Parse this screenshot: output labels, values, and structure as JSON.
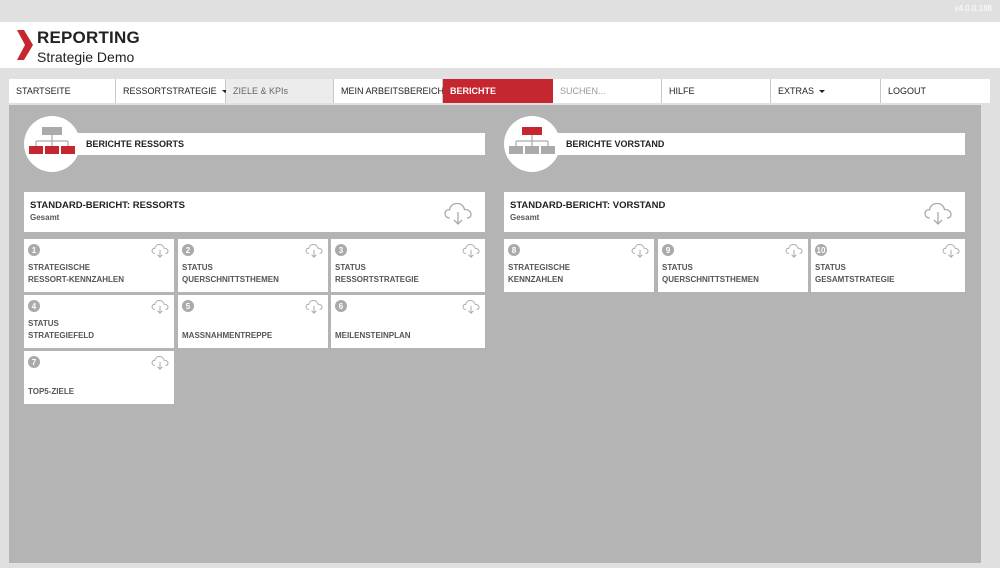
{
  "app": {
    "version": "v4.0.0.188",
    "title": "REPORTING",
    "subtitle": "Strategie Demo"
  },
  "nav": {
    "startseite": "STARTSEITE",
    "ressortstrategie": "RESSORTSTRATEGIE",
    "ziele": "ZIELE & KPIs",
    "arbeitsbereich": "MEIN ARBEITSBEREICH",
    "berichte": "BERICHTE",
    "search_placeholder": "SUCHEN...",
    "hilfe": "HILFE",
    "extras": "EXTRAS",
    "logout": "LOGOUT"
  },
  "left": {
    "section_title": "BERICHTE RESSORTS",
    "standard_title": "STANDARD-BERICHT: RESSORTS",
    "standard_sub": "Gesamt",
    "tiles": [
      {
        "num": "1",
        "label": "STRATEGISCHE\nRESSORT-KENNZAHLEN"
      },
      {
        "num": "2",
        "label": "STATUS\nQUERSCHNITTSTHEMEN"
      },
      {
        "num": "3",
        "label": "STATUS\nRESSORTSTRATEGIE"
      },
      {
        "num": "4",
        "label": "STATUS\nSTRATEGIEFELD"
      },
      {
        "num": "5",
        "label": "MASSNAHMENTREPPE"
      },
      {
        "num": "6",
        "label": "MEILENSTEINPLAN"
      },
      {
        "num": "7",
        "label": "TOP5-ZIELE"
      }
    ]
  },
  "right": {
    "section_title": "BERICHTE VORSTAND",
    "standard_title": "STANDARD-BERICHT: VORSTAND",
    "standard_sub": "Gesamt",
    "tiles": [
      {
        "num": "8",
        "label": "STRATEGISCHE\nKENNZAHLEN"
      },
      {
        "num": "9",
        "label": "STATUS\nQUERSCHNITTSTHEMEN"
      },
      {
        "num": "10",
        "label": "STATUS\nGESAMTSTRATEGIE"
      }
    ]
  },
  "colors": {
    "accent": "#c5262f",
    "content_bg": "#b4b4b4",
    "icon_grey": "#aaaaaa"
  }
}
